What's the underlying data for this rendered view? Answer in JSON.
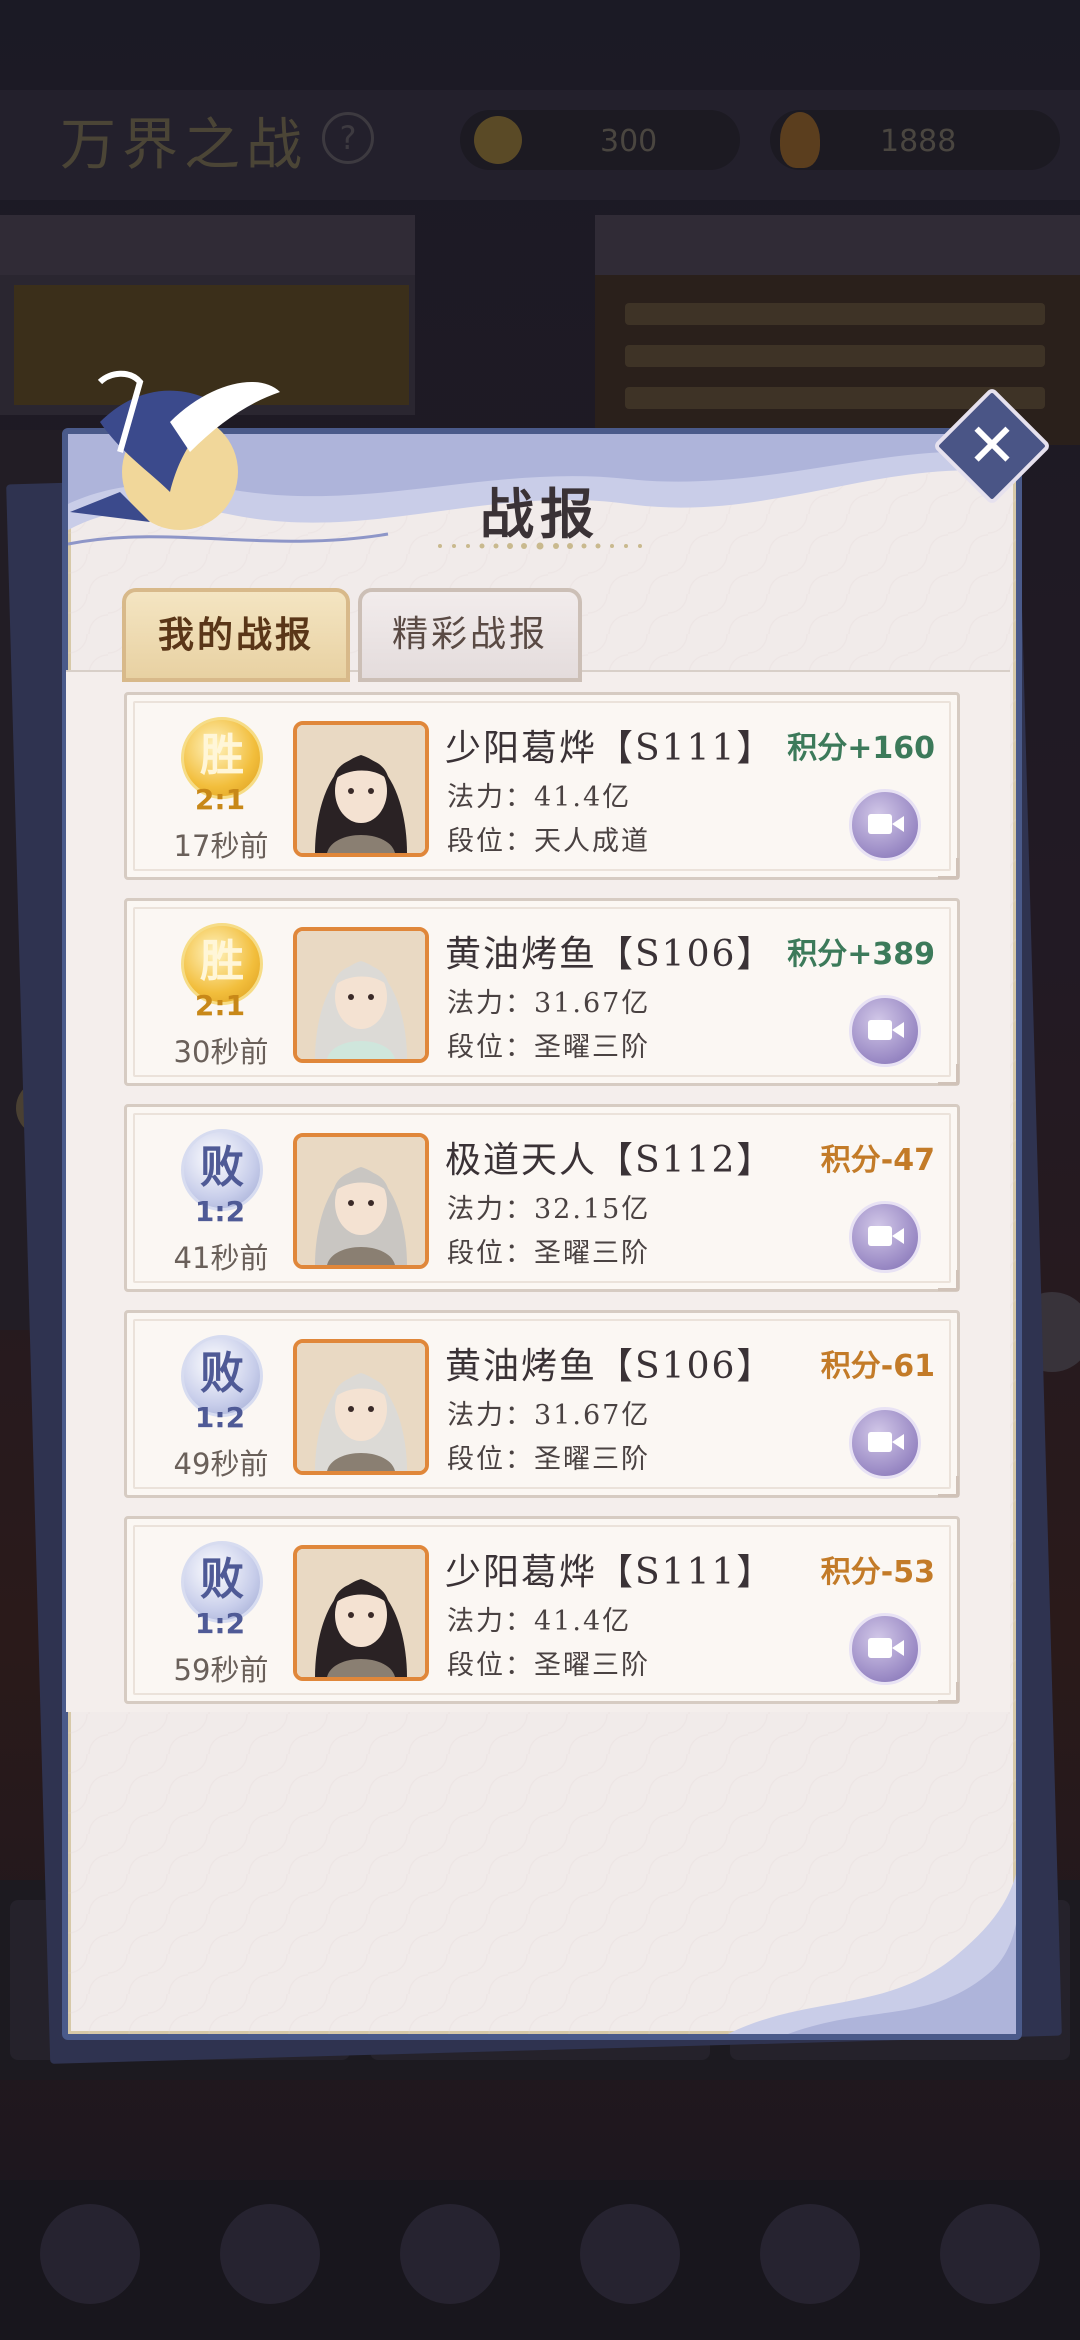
{
  "background": {
    "title": "万界之战",
    "help": "?",
    "currency1": "300",
    "currency2": "1888"
  },
  "modal": {
    "title": "战报",
    "close": "✕",
    "tabs": [
      {
        "label": "我的战报",
        "active": true
      },
      {
        "label": "精彩战报",
        "active": false
      }
    ],
    "reports": [
      {
        "result": "胜",
        "outcome": "win",
        "score": "2:1",
        "ago": "17秒前",
        "name": "少阳葛烨【S111】",
        "power": "法力：41.4亿",
        "rank": "段位：天人成道",
        "delta": "积分+160",
        "hair": "#2a2224"
      },
      {
        "result": "胜",
        "outcome": "win",
        "score": "2:1",
        "ago": "30秒前",
        "name": "黄油烤鱼【S106】",
        "power": "法力：31.67亿",
        "rank": "段位：圣曜三阶",
        "delta": "积分+389",
        "hair": "#dcdad6"
      },
      {
        "result": "败",
        "outcome": "lose",
        "score": "1:2",
        "ago": "41秒前",
        "name": "极道天人【S112】",
        "power": "法力：32.15亿",
        "rank": "段位：圣曜三阶",
        "delta": "积分-47",
        "hair": "#c9c6c2"
      },
      {
        "result": "败",
        "outcome": "lose",
        "score": "1:2",
        "ago": "49秒前",
        "name": "黄油烤鱼【S106】",
        "power": "法力：31.67亿",
        "rank": "段位：圣曜三阶",
        "delta": "积分-61",
        "hair": "#dcdad6"
      },
      {
        "result": "败",
        "outcome": "lose",
        "score": "1:2",
        "ago": "59秒前",
        "name": "少阳葛烨【S111】",
        "power": "法力：41.4亿",
        "rank": "段位：圣曜三阶",
        "delta": "积分-53",
        "hair": "#2a2224"
      }
    ]
  }
}
